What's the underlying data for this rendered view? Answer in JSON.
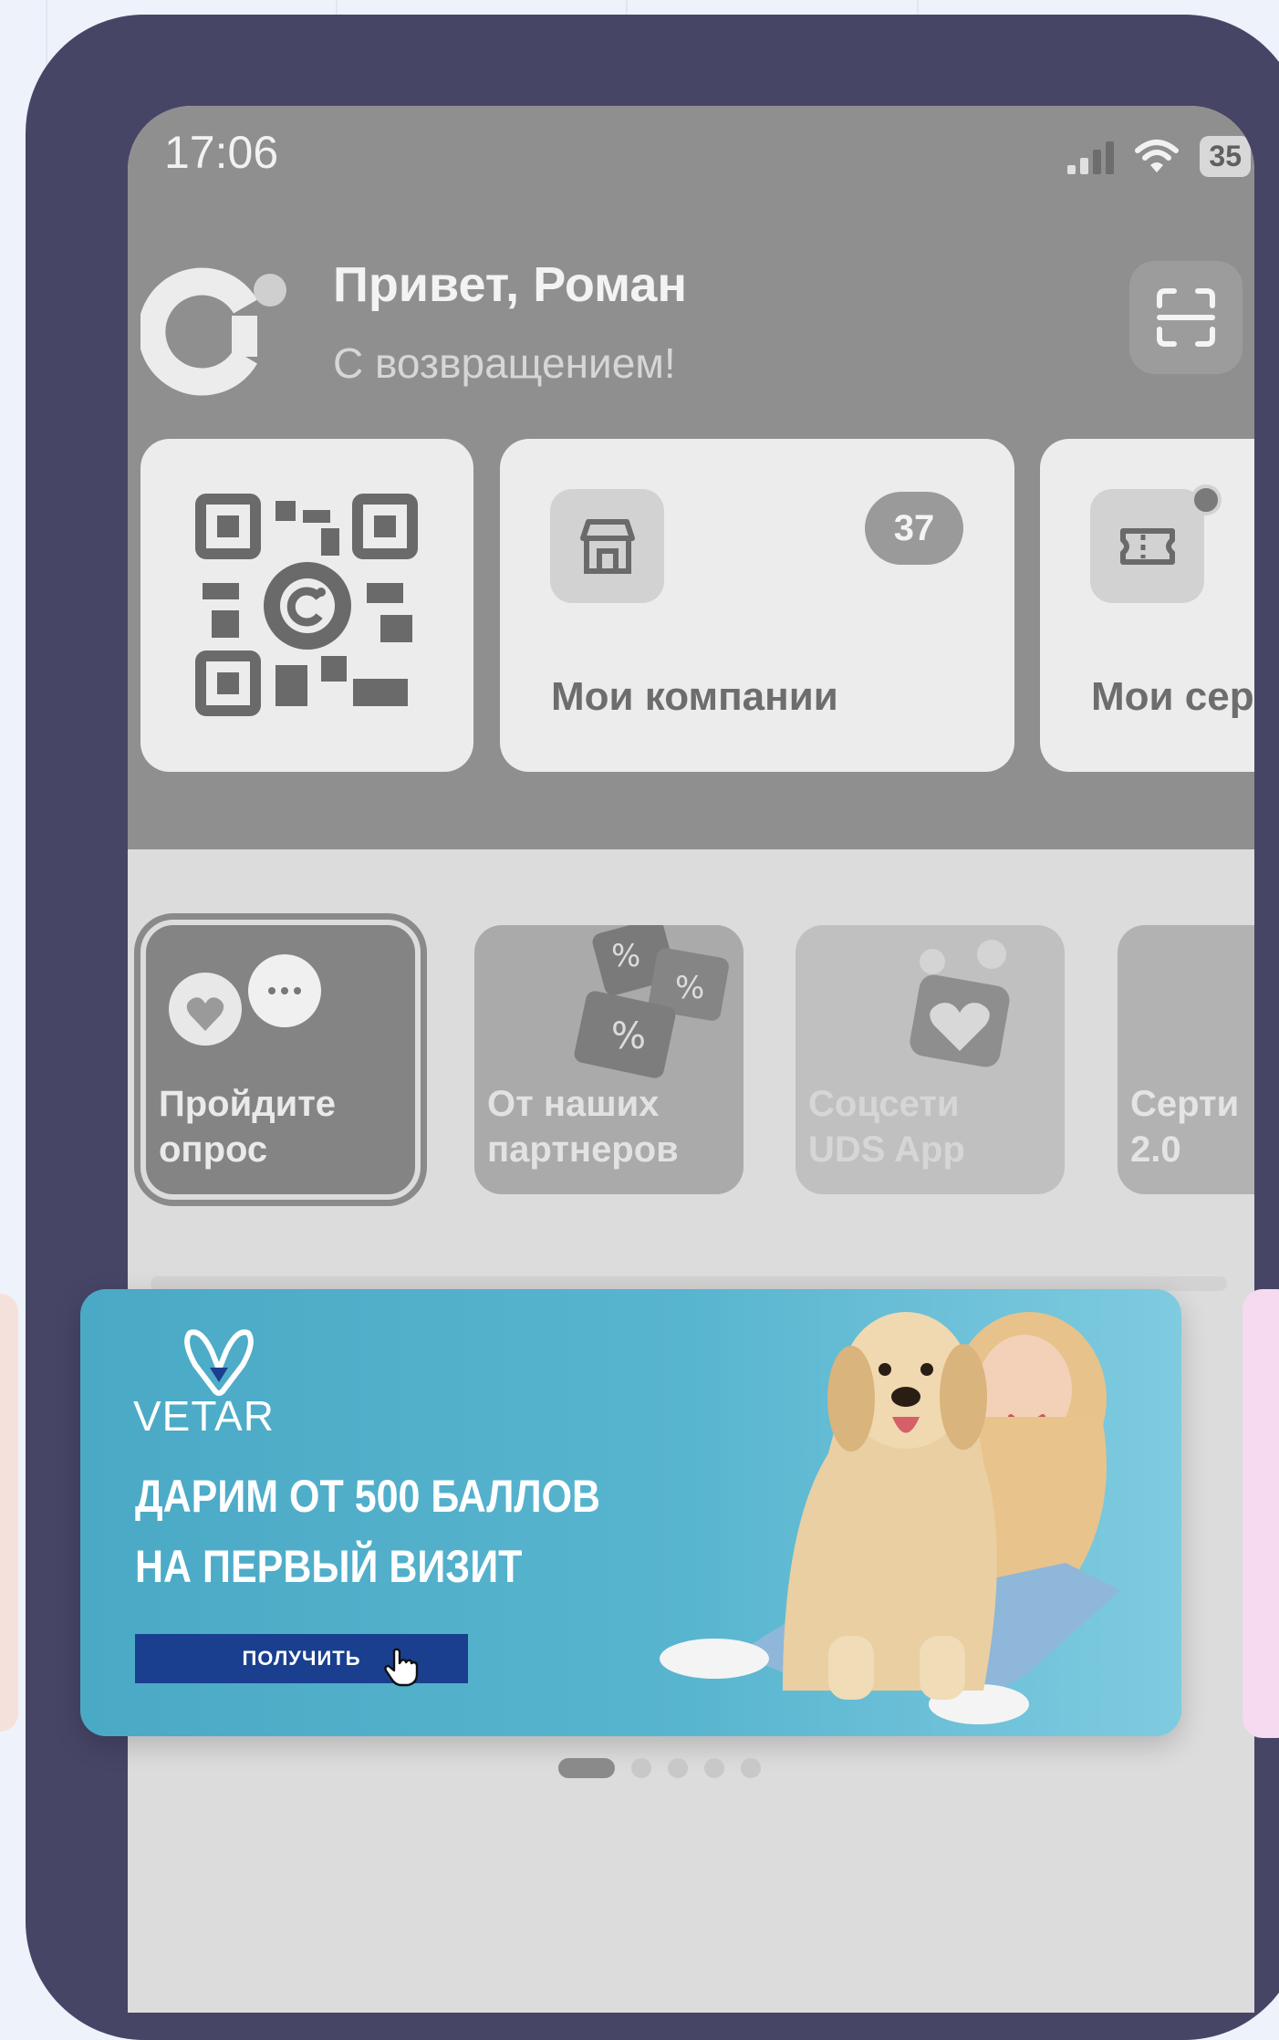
{
  "status_bar": {
    "time": "17:06",
    "battery": "35"
  },
  "header": {
    "greeting": "Привет, Роман",
    "subtitle": "С возвращением!"
  },
  "cards": {
    "companies": {
      "label": "Мои компании",
      "badge": "37"
    },
    "certificates": {
      "label": "Мои сер"
    }
  },
  "stories": [
    {
      "label_line1": "Пройдите",
      "label_line2": "опрос"
    },
    {
      "label_line1": "От наших",
      "label_line2": "партнеров"
    },
    {
      "label_line1": "Соцсети",
      "label_line2": "UDS App"
    },
    {
      "label_line1": "Серти",
      "label_line2": "2.0"
    }
  ],
  "banner": {
    "brand": "VETAR",
    "line1": "ДАРИМ ОТ 500 БАЛЛОВ",
    "line2": "НА ПЕРВЫЙ ВИЗИТ",
    "cta": "ПОЛУЧИТЬ",
    "color_bg": "#4aa9c5",
    "color_button": "#1a3f8f"
  },
  "pager": {
    "count": 5,
    "active_index": 0
  },
  "colors": {
    "phone_frame": "#474566",
    "page_bg": "#eef2fb"
  }
}
